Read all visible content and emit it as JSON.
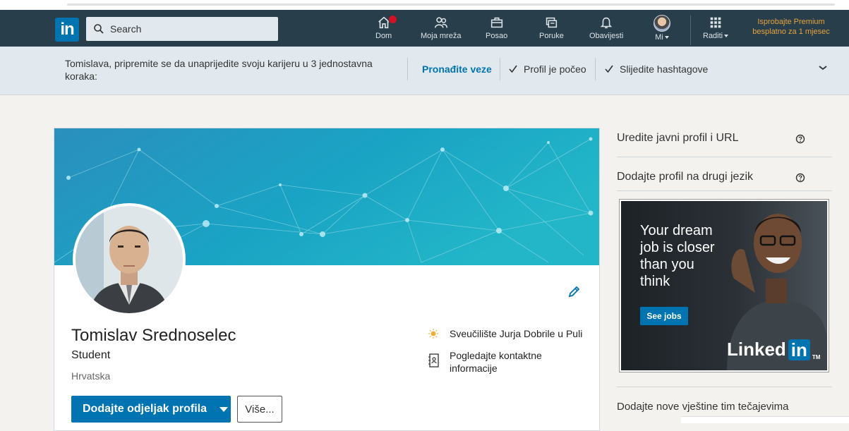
{
  "logo": {
    "text": "in"
  },
  "search": {
    "placeholder": "Search"
  },
  "nav": {
    "items": [
      {
        "label": "Dom",
        "icon": "home-icon"
      },
      {
        "label": "Moja mreža",
        "icon": "network-icon"
      },
      {
        "label": "Posao",
        "icon": "briefcase-icon"
      },
      {
        "label": "Poruke",
        "icon": "messages-icon"
      },
      {
        "label": "Obavijesti",
        "icon": "bell-icon"
      },
      {
        "label": "Mi",
        "icon": "avatar"
      },
      {
        "label": "Raditi",
        "icon": "grid-icon"
      }
    ],
    "premium": {
      "line1": "Isprobajte Premium",
      "line2": "besplatno za 1 mjesec"
    }
  },
  "onboarding": {
    "message": "Tomislava, pripremite se da unaprijedite svoju karijeru u 3 jednostavna koraka:",
    "steps": [
      {
        "label": "Pronađite veze",
        "done": false
      },
      {
        "label": "Profil je počeo",
        "done": true
      },
      {
        "label": "Slijedite hashtagove",
        "done": true
      }
    ]
  },
  "profile": {
    "name": "Tomislav Srednoselec",
    "headline": "Student",
    "location": "Hrvatska",
    "add_section_label": "Dodajte odjeljak profila",
    "more_label": "Više...",
    "school": "Sveučilište Jurja Dobrile u Puli",
    "contact_line1": "Pogledajte kontaktne",
    "contact_line2": "informacije"
  },
  "sidebar": {
    "edit_public_profile": "Uredite javni profil i URL",
    "add_language_profile": "Dodajte profil na drugi jezik",
    "ad": {
      "line1": "Your dream",
      "line2": "job is closer",
      "line3": "than you",
      "line4": "think",
      "button": "See jobs",
      "brand_word": "Linked",
      "brand_in": "in",
      "brand_tm": "TM"
    },
    "skills_link": "Dodajte nove vještine tim tečajevima"
  },
  "colors": {
    "navbar": "#283e4a",
    "brand_blue": "#0073b1",
    "onboarding_bg": "#e1e9ee",
    "premium_gold": "#e7a33e"
  }
}
